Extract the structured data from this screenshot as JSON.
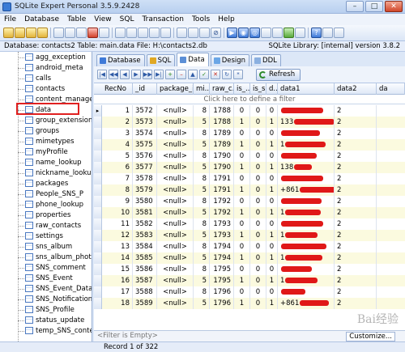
{
  "window": {
    "title": "SQLite Expert Personal 3.5.9.2428"
  },
  "menu": [
    "File",
    "Database",
    "Table",
    "View",
    "SQL",
    "Transaction",
    "Tools",
    "Help"
  ],
  "info": {
    "left": "Database: contacts2  Table: main.data  File: H:\\contacts2.db",
    "right": "SQLite Library: [internal] version 3.8.2"
  },
  "tree": {
    "items": [
      "agg_exception",
      "android_meta",
      "calls",
      "contacts",
      "content_manage",
      "data",
      "group_extension",
      "groups",
      "mimetypes",
      "myProfile",
      "name_lookup",
      "nickname_lookup",
      "packages",
      "People_SNS_P",
      "phone_lookup",
      "properties",
      "raw_contacts",
      "settings",
      "sns_album",
      "sns_album_photo",
      "SNS_comment",
      "SNS_Event",
      "SNS_Event_Data",
      "SNS_Notification",
      "SNS_Profile",
      "status_update",
      "temp_SNS_content"
    ],
    "selected": "data"
  },
  "tabs": [
    "Database",
    "SQL",
    "Data",
    "Design",
    "DDL"
  ],
  "active_tab": "Data",
  "refresh_label": "Refresh",
  "grid": {
    "columns": [
      "RecNo",
      "_id",
      "package_id",
      "mi...",
      "raw_c...",
      "is_...",
      "is_s...",
      "d...",
      "data1",
      "data2",
      "da"
    ],
    "filter_hint": "Click here to define a filter",
    "rows": [
      [
        "1",
        "3572",
        "<null>",
        "8",
        "1788",
        "0",
        "0",
        "0",
        "",
        "2"
      ],
      [
        "2",
        "3573",
        "<null>",
        "5",
        "1788",
        "1",
        "0",
        "1",
        "133",
        "2"
      ],
      [
        "3",
        "3574",
        "<null>",
        "8",
        "1789",
        "0",
        "0",
        "0",
        "",
        "2"
      ],
      [
        "4",
        "3575",
        "<null>",
        "5",
        "1789",
        "1",
        "0",
        "1",
        "1",
        "2"
      ],
      [
        "5",
        "3576",
        "<null>",
        "8",
        "1790",
        "0",
        "0",
        "0",
        "",
        "2"
      ],
      [
        "6",
        "3577",
        "<null>",
        "5",
        "1790",
        "1",
        "0",
        "1",
        "138",
        "2"
      ],
      [
        "7",
        "3578",
        "<null>",
        "8",
        "1791",
        "0",
        "0",
        "0",
        "",
        "2"
      ],
      [
        "8",
        "3579",
        "<null>",
        "5",
        "1791",
        "1",
        "0",
        "1",
        "+861",
        "2"
      ],
      [
        "9",
        "3580",
        "<null>",
        "8",
        "1792",
        "0",
        "0",
        "0",
        "",
        "2"
      ],
      [
        "10",
        "3581",
        "<null>",
        "5",
        "1792",
        "1",
        "0",
        "1",
        "1",
        "2"
      ],
      [
        "11",
        "3582",
        "<null>",
        "8",
        "1793",
        "0",
        "0",
        "0",
        "",
        "2"
      ],
      [
        "12",
        "3583",
        "<null>",
        "5",
        "1793",
        "1",
        "0",
        "1",
        "1",
        "2"
      ],
      [
        "13",
        "3584",
        "<null>",
        "8",
        "1794",
        "0",
        "0",
        "0",
        "",
        "2"
      ],
      [
        "14",
        "3585",
        "<null>",
        "5",
        "1794",
        "1",
        "0",
        "1",
        "1",
        "2"
      ],
      [
        "15",
        "3586",
        "<null>",
        "8",
        "1795",
        "0",
        "0",
        "0",
        "",
        "2"
      ],
      [
        "16",
        "3587",
        "<null>",
        "5",
        "1795",
        "1",
        "0",
        "1",
        "1",
        "2"
      ],
      [
        "17",
        "3588",
        "<null>",
        "8",
        "1796",
        "0",
        "0",
        "0",
        "",
        "2"
      ],
      [
        "18",
        "3589",
        "<null>",
        "5",
        "1796",
        "1",
        "0",
        "1",
        "+861",
        "2"
      ]
    ],
    "filter_empty": "<Filter is Empty>",
    "customize": "Customize..."
  },
  "status": {
    "record": "Record 1 of 322"
  },
  "watermark": "Bai经验"
}
